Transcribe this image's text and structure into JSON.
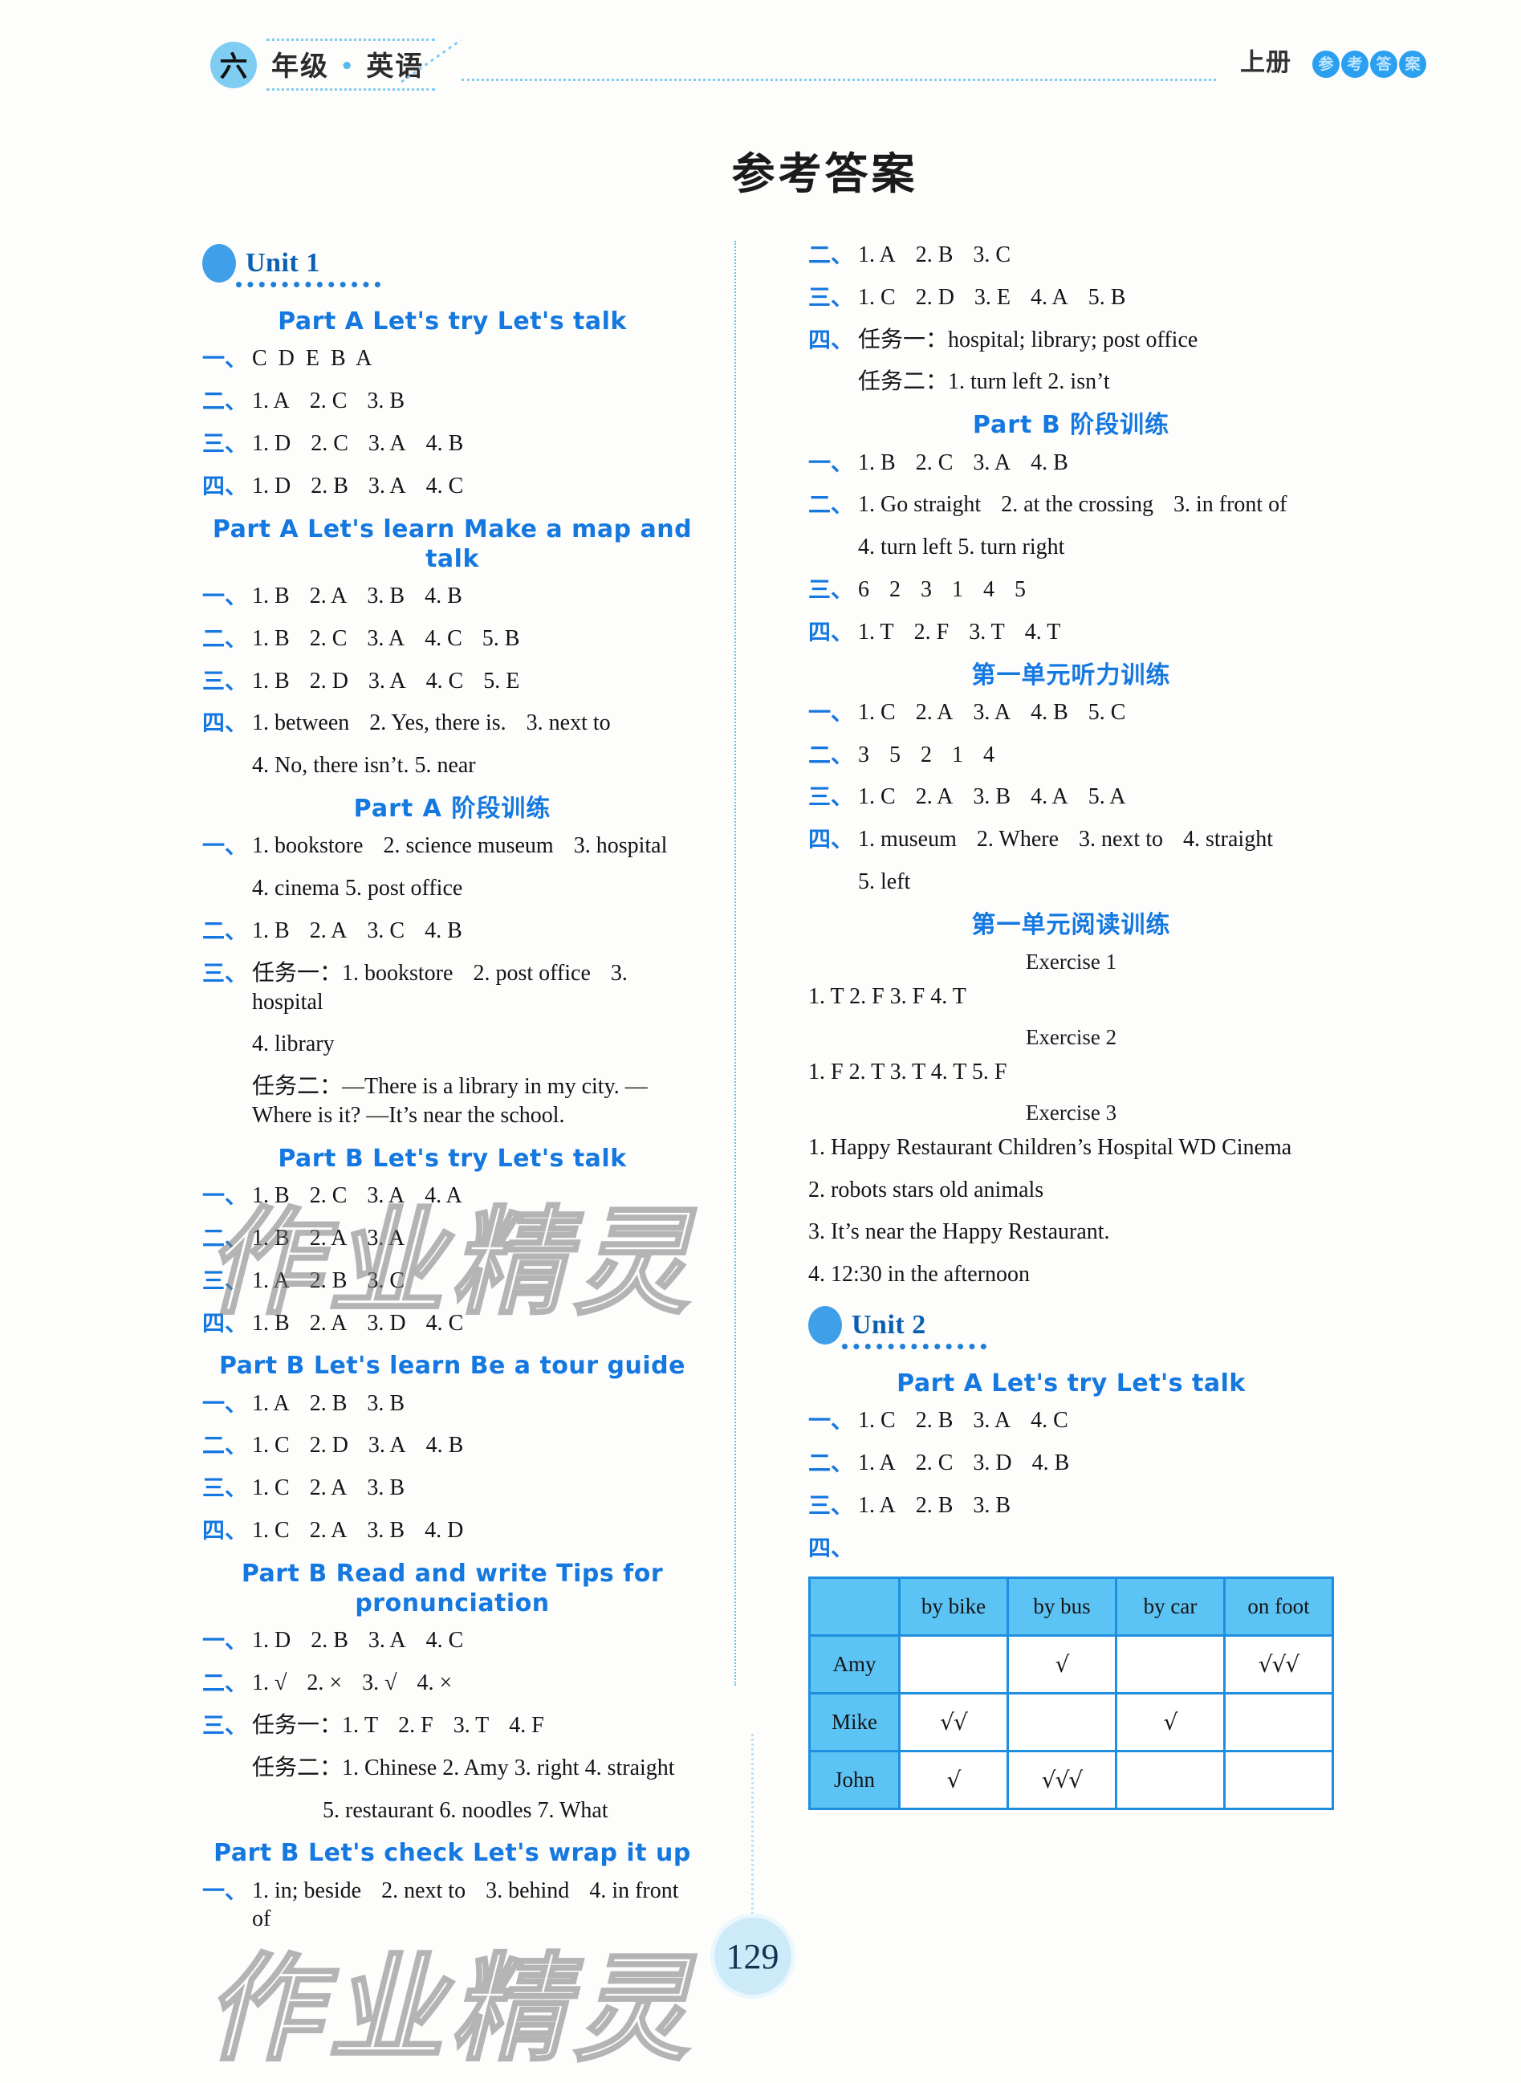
{
  "header": {
    "grade_badge": "六",
    "grade_text": "年级",
    "dot_separator": "•",
    "subject": "英语",
    "volume": "上册",
    "answer_chars": [
      "参",
      "考",
      "答",
      "案"
    ]
  },
  "main_title": "参考答案",
  "page_number": "129",
  "watermark": "作业精灵",
  "colors": {
    "heading_blue": "#1478e0",
    "unit_blue": "#0b5fb0",
    "badge_blue": "#3f9fe8",
    "table_header": "#5cc3f5",
    "table_border": "#1e8fe0",
    "header_cyan": "#7fcdf3"
  },
  "left_column": [
    {
      "kind": "unit",
      "label": "Unit 1"
    },
    {
      "kind": "section",
      "lines": [
        "Part A   Let's try   Let's talk"
      ]
    },
    {
      "kind": "answer",
      "num": "一、",
      "body": "C  D  E  B  A"
    },
    {
      "kind": "answer",
      "num": "二、",
      "body": "1. A   2. C   3. B"
    },
    {
      "kind": "answer",
      "num": "三、",
      "body": "1. D   2. C   3. A   4. B"
    },
    {
      "kind": "answer",
      "num": "四、",
      "body": "1. D   2. B   3. A   4. C"
    },
    {
      "kind": "section",
      "lines": [
        "Part A   Let's learn   Make a map and talk"
      ]
    },
    {
      "kind": "answer",
      "num": "一、",
      "body": "1. B   2. A   3. B   4. B"
    },
    {
      "kind": "answer",
      "num": "二、",
      "body": "1. B   2. C   3. A   4. C   5. B"
    },
    {
      "kind": "answer",
      "num": "三、",
      "body": "1. B   2. D   3. A   4. C   5. E"
    },
    {
      "kind": "answer",
      "num": "四、",
      "body": "1. between   2. Yes, there is.    3. next to"
    },
    {
      "kind": "cont",
      "body": "4. No, there isn’t.    5. near"
    },
    {
      "kind": "section",
      "cn": true,
      "lines": [
        "Part A 阶段训练"
      ]
    },
    {
      "kind": "answer",
      "num": "一、",
      "body": "1. bookstore   2. science museum   3. hospital"
    },
    {
      "kind": "cont",
      "body": "4. cinema   5. post office"
    },
    {
      "kind": "answer",
      "num": "二、",
      "body": "1. B   2. A   3. C   4. B"
    },
    {
      "kind": "answer",
      "num": "三、",
      "body": "任务一：1. bookstore   2. post office   3. hospital"
    },
    {
      "kind": "cont",
      "body": "4. library"
    },
    {
      "kind": "cont",
      "body": "任务二：—There is a library in my city. —Where is it? —It’s near the school."
    },
    {
      "kind": "section",
      "lines": [
        "Part B   Let's try   Let's talk"
      ]
    },
    {
      "kind": "answer",
      "num": "一、",
      "body": "1. B   2. C   3. A   4. A"
    },
    {
      "kind": "answer",
      "num": "二、",
      "body": "1. B   2. A   3. A"
    },
    {
      "kind": "answer",
      "num": "三、",
      "body": "1. A   2. B   3. C"
    },
    {
      "kind": "answer",
      "num": "四、",
      "body": "1. B   2. A   3. D   4. C"
    },
    {
      "kind": "section",
      "lines": [
        "Part B   Let's learn   Be a tour guide"
      ]
    },
    {
      "kind": "answer",
      "num": "一、",
      "body": "1. A   2. B   3. B"
    },
    {
      "kind": "answer",
      "num": "二、",
      "body": "1. C   2. D   3. A   4. B"
    },
    {
      "kind": "answer",
      "num": "三、",
      "body": "1. C   2. A   3. B"
    },
    {
      "kind": "answer",
      "num": "四、",
      "body": "1. C   2. A   3. B   4. D"
    },
    {
      "kind": "section",
      "lines": [
        "Part B   Read and write   Tips for",
        "pronunciation"
      ]
    },
    {
      "kind": "answer",
      "num": "一、",
      "body": "1. D   2. B   3. A   4. C"
    },
    {
      "kind": "answer",
      "num": "二、",
      "body": "1. √   2. ×   3. √   4. ×"
    },
    {
      "kind": "answer",
      "num": "三、",
      "body": "任务一：1. T   2. F   3. T   4. F"
    },
    {
      "kind": "cont",
      "body": "任务二：1. Chinese   2. Amy   3. right   4. straight"
    },
    {
      "kind": "cont2",
      "body": "5. restaurant   6. noodles   7. What"
    },
    {
      "kind": "section",
      "lines": [
        "Part B   Let's check   Let's wrap it up"
      ]
    },
    {
      "kind": "answer",
      "num": "一、",
      "body": "1. in; beside   2. next to   3. behind   4. in front of"
    }
  ],
  "right_column": [
    {
      "kind": "answer",
      "num": "二、",
      "body": "1. A   2. B   3. C"
    },
    {
      "kind": "answer",
      "num": "三、",
      "body": "1. C   2. D   3. E   4. A   5. B"
    },
    {
      "kind": "answer",
      "num": "四、",
      "body": "任务一：hospital; library; post office"
    },
    {
      "kind": "cont",
      "body": "任务二：1. turn left   2. isn’t"
    },
    {
      "kind": "section",
      "cn": true,
      "lines": [
        "Part B 阶段训练"
      ]
    },
    {
      "kind": "answer",
      "num": "一、",
      "body": "1. B   2. C   3. A   4. B"
    },
    {
      "kind": "answer",
      "num": "二、",
      "body": "1. Go straight   2. at the crossing   3. in front of"
    },
    {
      "kind": "cont",
      "body": "4. turn left   5. turn right"
    },
    {
      "kind": "answer",
      "num": "三、",
      "body": "6   2   3   1   4   5"
    },
    {
      "kind": "answer",
      "num": "四、",
      "body": "1. T   2. F   3. T   4. T"
    },
    {
      "kind": "section",
      "cn": true,
      "lines": [
        "第一单元听力训练"
      ]
    },
    {
      "kind": "answer",
      "num": "一、",
      "body": "1. C   2. A   3. A   4. B   5. C"
    },
    {
      "kind": "answer",
      "num": "二、",
      "body": "3   5   2   1   4"
    },
    {
      "kind": "answer",
      "num": "三、",
      "body": "1. C   2. A   3. B   4. A   5. A"
    },
    {
      "kind": "answer",
      "num": "四、",
      "body": "1. museum   2. Where   3. next to   4. straight"
    },
    {
      "kind": "cont",
      "body": "5. left"
    },
    {
      "kind": "section",
      "cn": true,
      "lines": [
        "第一单元阅读训练"
      ]
    },
    {
      "kind": "exlabel",
      "body": "Exercise 1"
    },
    {
      "kind": "plain",
      "body": "1. T   2. F   3. F   4. T"
    },
    {
      "kind": "exlabel",
      "body": "Exercise 2"
    },
    {
      "kind": "plain",
      "body": "1. F   2. T   3. T   4. T   5. F"
    },
    {
      "kind": "exlabel",
      "body": "Exercise 3"
    },
    {
      "kind": "plain",
      "body": "1. Happy Restaurant   Children’s Hospital   WD Cinema"
    },
    {
      "kind": "plain",
      "body": "2. robots   stars   old animals"
    },
    {
      "kind": "plain",
      "body": "3. It’s near the Happy Restaurant."
    },
    {
      "kind": "plain",
      "body": "4. 12:30 in the afternoon"
    },
    {
      "kind": "unit",
      "label": "Unit 2"
    },
    {
      "kind": "section",
      "lines": [
        "Part A   Let's try   Let's talk"
      ]
    },
    {
      "kind": "answer",
      "num": "一、",
      "body": "1. C   2. B   3. A   4. C"
    },
    {
      "kind": "answer",
      "num": "二、",
      "body": "1. A   2. C   3. D   4. B"
    },
    {
      "kind": "answer",
      "num": "三、",
      "body": "1. A   2. B   3. B"
    },
    {
      "kind": "answer",
      "num": "四、",
      "body": ""
    },
    {
      "kind": "table"
    }
  ],
  "transport_table": {
    "corner": "",
    "columns": [
      "by bike",
      "by bus",
      "by car",
      "on foot"
    ],
    "rows": [
      {
        "name": "Amy",
        "cells": [
          "",
          "√",
          "",
          "√√√"
        ]
      },
      {
        "name": "Mike",
        "cells": [
          "√√",
          "",
          "√",
          ""
        ]
      },
      {
        "name": "John",
        "cells": [
          "√",
          "√√√",
          "",
          ""
        ]
      }
    ]
  }
}
